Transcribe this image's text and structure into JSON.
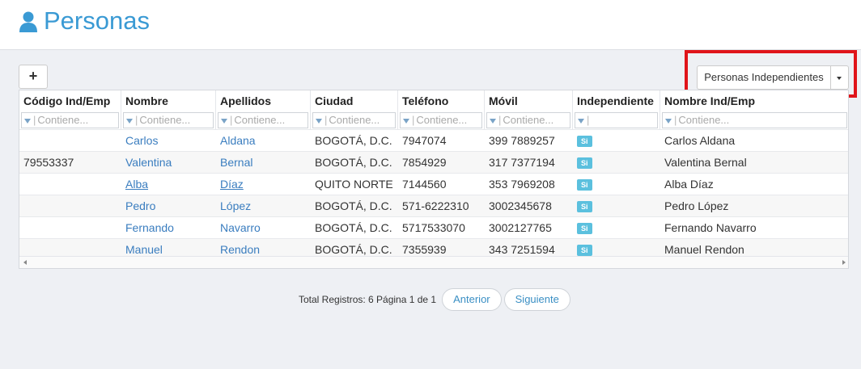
{
  "header": {
    "title": "Personas",
    "icon": "user-icon"
  },
  "toolbar": {
    "add_label": "+",
    "filter_selected": "Personas Independientes"
  },
  "grid": {
    "columns": [
      "Código Ind/Emp",
      "Nombre",
      "Apellidos",
      "Ciudad",
      "Teléfono",
      "Móvil",
      "Independiente",
      "Nombre Ind/Emp"
    ],
    "filter_placeholder": "Contiene...",
    "rows": [
      {
        "codigo": "",
        "nombre": "Carlos",
        "apellidos": "Aldana",
        "ciudad": "BOGOTÁ, D.C.",
        "telefono": "7947074",
        "movil": "399 7889257",
        "independiente": "Si",
        "nombre_ind": "Carlos Aldana"
      },
      {
        "codigo": "79553337",
        "nombre": "Valentina",
        "apellidos": "Bernal",
        "ciudad": "BOGOTÁ, D.C.",
        "telefono": "7854929",
        "movil": "317 7377194",
        "independiente": "Si",
        "nombre_ind": "Valentina Bernal"
      },
      {
        "codigo": "",
        "nombre": "Alba",
        "apellidos": "Díaz",
        "ciudad": "QUITO NORTE",
        "telefono": "7144560",
        "movil": "353 7969208",
        "independiente": "Si",
        "nombre_ind": "Alba Díaz"
      },
      {
        "codigo": "",
        "nombre": "Pedro",
        "apellidos": "López",
        "ciudad": "BOGOTÁ, D.C.",
        "telefono": "571-6222310",
        "movil": "3002345678",
        "independiente": "Si",
        "nombre_ind": "Pedro López"
      },
      {
        "codigo": "",
        "nombre": "Fernando",
        "apellidos": "Navarro",
        "ciudad": "BOGOTÁ, D.C.",
        "telefono": "5717533070",
        "movil": "3002127765",
        "independiente": "Si",
        "nombre_ind": "Fernando Navarro"
      },
      {
        "codigo": "",
        "nombre": "Manuel",
        "apellidos": "Rendon",
        "ciudad": "BOGOTÁ, D.C.",
        "telefono": "7355939",
        "movil": "343 7251594",
        "independiente": "Si",
        "nombre_ind": "Manuel Rendon"
      }
    ]
  },
  "pager": {
    "info": "Total Registros: 6 Página 1 de 1",
    "prev_label": "Anterior",
    "next_label": "Siguiente"
  },
  "colors": {
    "accent": "#3a9ad4",
    "link": "#3a7dbf",
    "badge": "#5bc0de",
    "highlight": "#e0141a"
  }
}
